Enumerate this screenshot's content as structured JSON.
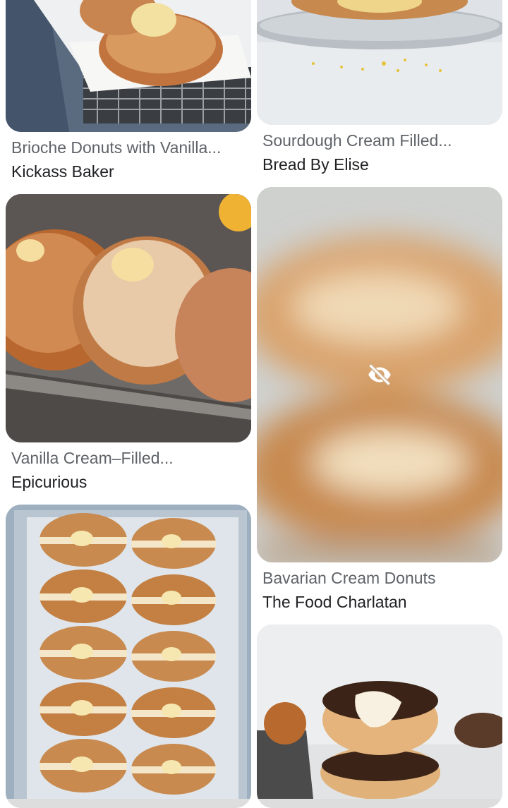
{
  "results": [
    {
      "title": "Brioche Donuts with Vanilla...",
      "source": "Kickass Baker",
      "image": "sugar-donuts-in-tray-photo"
    },
    {
      "title": "Sourdough Cream Filled...",
      "source": "Bread By Elise",
      "image": "donut-on-glass-plate-photo"
    },
    {
      "title": "Vanilla Cream–Filled...",
      "source": "Epicurious",
      "image": "sugar-donuts-on-pan-photo"
    },
    {
      "title": "Bavarian Cream Donuts",
      "source": "The Food Charlatan",
      "image": "blurred-hidden-photo",
      "hidden_icon": "eye-off-icon"
    },
    {
      "title": "",
      "source": "",
      "image": "cream-donuts-rows-in-tray-photo"
    },
    {
      "title": "",
      "source": "",
      "image": "chocolate-glazed-donuts-photo"
    }
  ]
}
